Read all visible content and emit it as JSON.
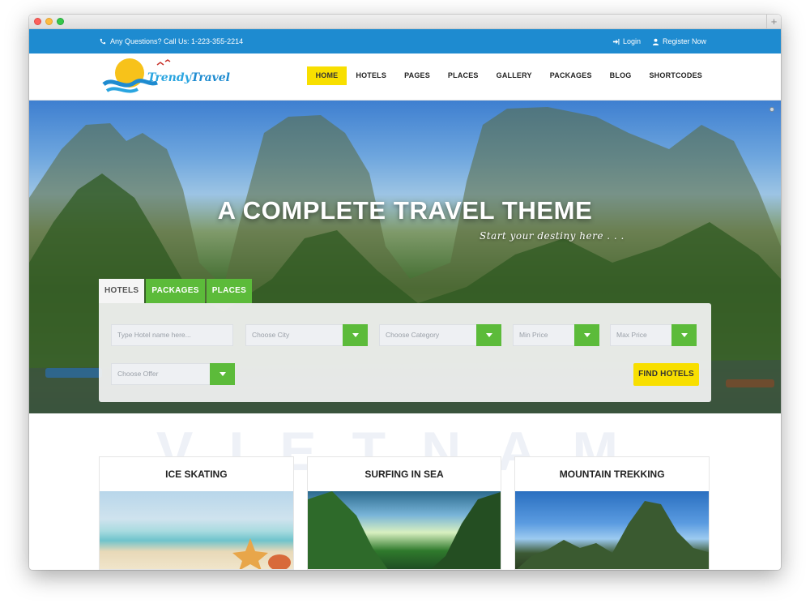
{
  "topbar": {
    "contact": "Any Questions? Call Us: 1-223-355-2214",
    "login": "Login",
    "register": "Register Now"
  },
  "brand": {
    "logo_word1": "Trendy",
    "logo_word2": "Travel"
  },
  "nav": {
    "items": [
      "HOME",
      "HOTELS",
      "PAGES",
      "PLACES",
      "GALLERY",
      "PACKAGES",
      "BLOG",
      "SHORTCODES"
    ],
    "active": "HOME"
  },
  "hero": {
    "title": "A COMPLETE TRAVEL THEME",
    "subtitle": "Start your destiny here . . ."
  },
  "search": {
    "tabs": [
      "HOTELS",
      "PACKAGES",
      "PLACES"
    ],
    "active_tab": "HOTELS",
    "hotel_name_placeholder": "Type Hotel name here...",
    "city": "Choose City",
    "category": "Choose Category",
    "min_price": "Min Price",
    "max_price": "Max Price",
    "offer": "Choose Offer",
    "find_button": "FIND HOTELS"
  },
  "watermark": "VIETNAM",
  "cards": [
    {
      "title": "ICE SKATING"
    },
    {
      "title": "SURFING IN SEA"
    },
    {
      "title": "MOUNTAIN TREKKING"
    }
  ],
  "colors": {
    "topbar": "#1e8bd0",
    "nav_active": "#f8df00",
    "green": "#5cbb3a",
    "find_button": "#f8df00"
  },
  "icons": {
    "phone": "phone-icon",
    "login": "sign-in-icon",
    "register": "user-icon",
    "dropdown": "chevron-down-icon"
  }
}
